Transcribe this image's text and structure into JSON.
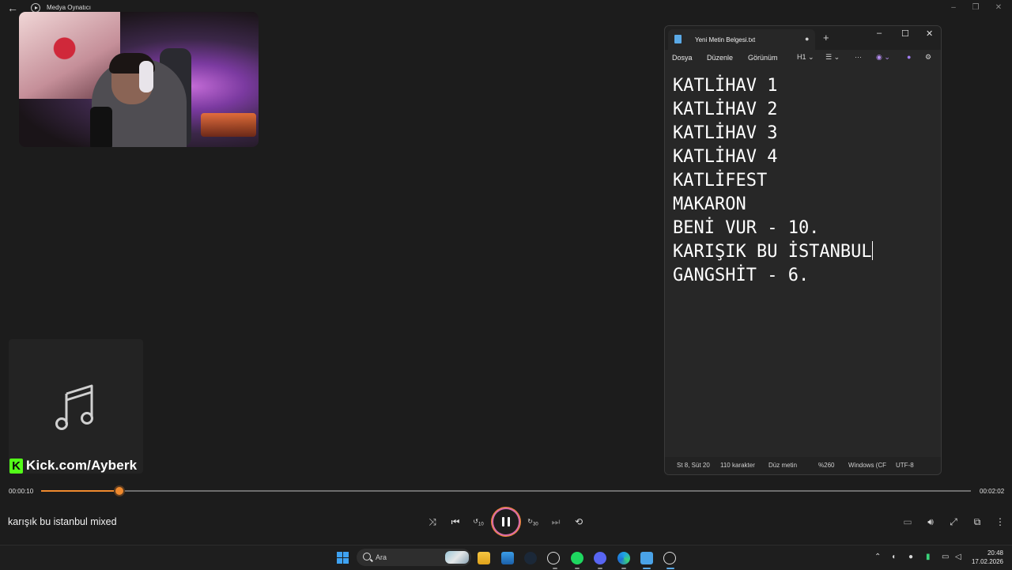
{
  "media_player": {
    "title": "Medya Oynatıcı",
    "track_title": "karışık bu istanbul mixed",
    "time_elapsed": "00:00:10",
    "time_total": "00:02:02",
    "progress": 0.084,
    "accent_color": "#f08a2e",
    "overlay_brand": "Kick.com/Ayberk",
    "overlay_brand_letter": "K",
    "controls": [
      "shuffle-icon",
      "previous-icon",
      "rewind-10-icon",
      "pause-icon",
      "forward-30-icon",
      "next-icon",
      "repeat-off-icon"
    ],
    "right_controls": [
      "miniplayer-icon",
      "volume-icon",
      "fullscreen-icon",
      "cast-icon",
      "more-icon"
    ],
    "rewind_label": "10",
    "forward_label": "30"
  },
  "notepad": {
    "tab_title": "Yeni Metin Belgesi.txt",
    "menu": [
      "Dosya",
      "Düzenle",
      "Görünüm"
    ],
    "heading_button": "H1",
    "lines": [
      "KATLİHAV 1",
      "KATLİHAV 2",
      "KATLİHAV 3",
      "KATLİHAV 4",
      "KATLİFEST",
      "MAKARON",
      "BENİ VUR - 10.",
      "KARIŞIK BU İSTANBUL",
      "GANGSHİT - 6."
    ],
    "status": {
      "position": "St 8, Süt 20",
      "chars": "110 karakter",
      "format": "Düz metin",
      "zoom": "%260",
      "line_ending": "Windows (CF",
      "encoding": "UTF-8"
    }
  },
  "taskbar": {
    "search_placeholder": "Ara",
    "clock_time": "20:48",
    "clock_date": "17.02.2026",
    "pinned": [
      "file-explorer-icon",
      "photos-icon",
      "steam-icon",
      "chatgpt-icon",
      "spotify-icon",
      "discord-icon",
      "edge-icon",
      "notepad-icon",
      "media-player-icon"
    ]
  }
}
